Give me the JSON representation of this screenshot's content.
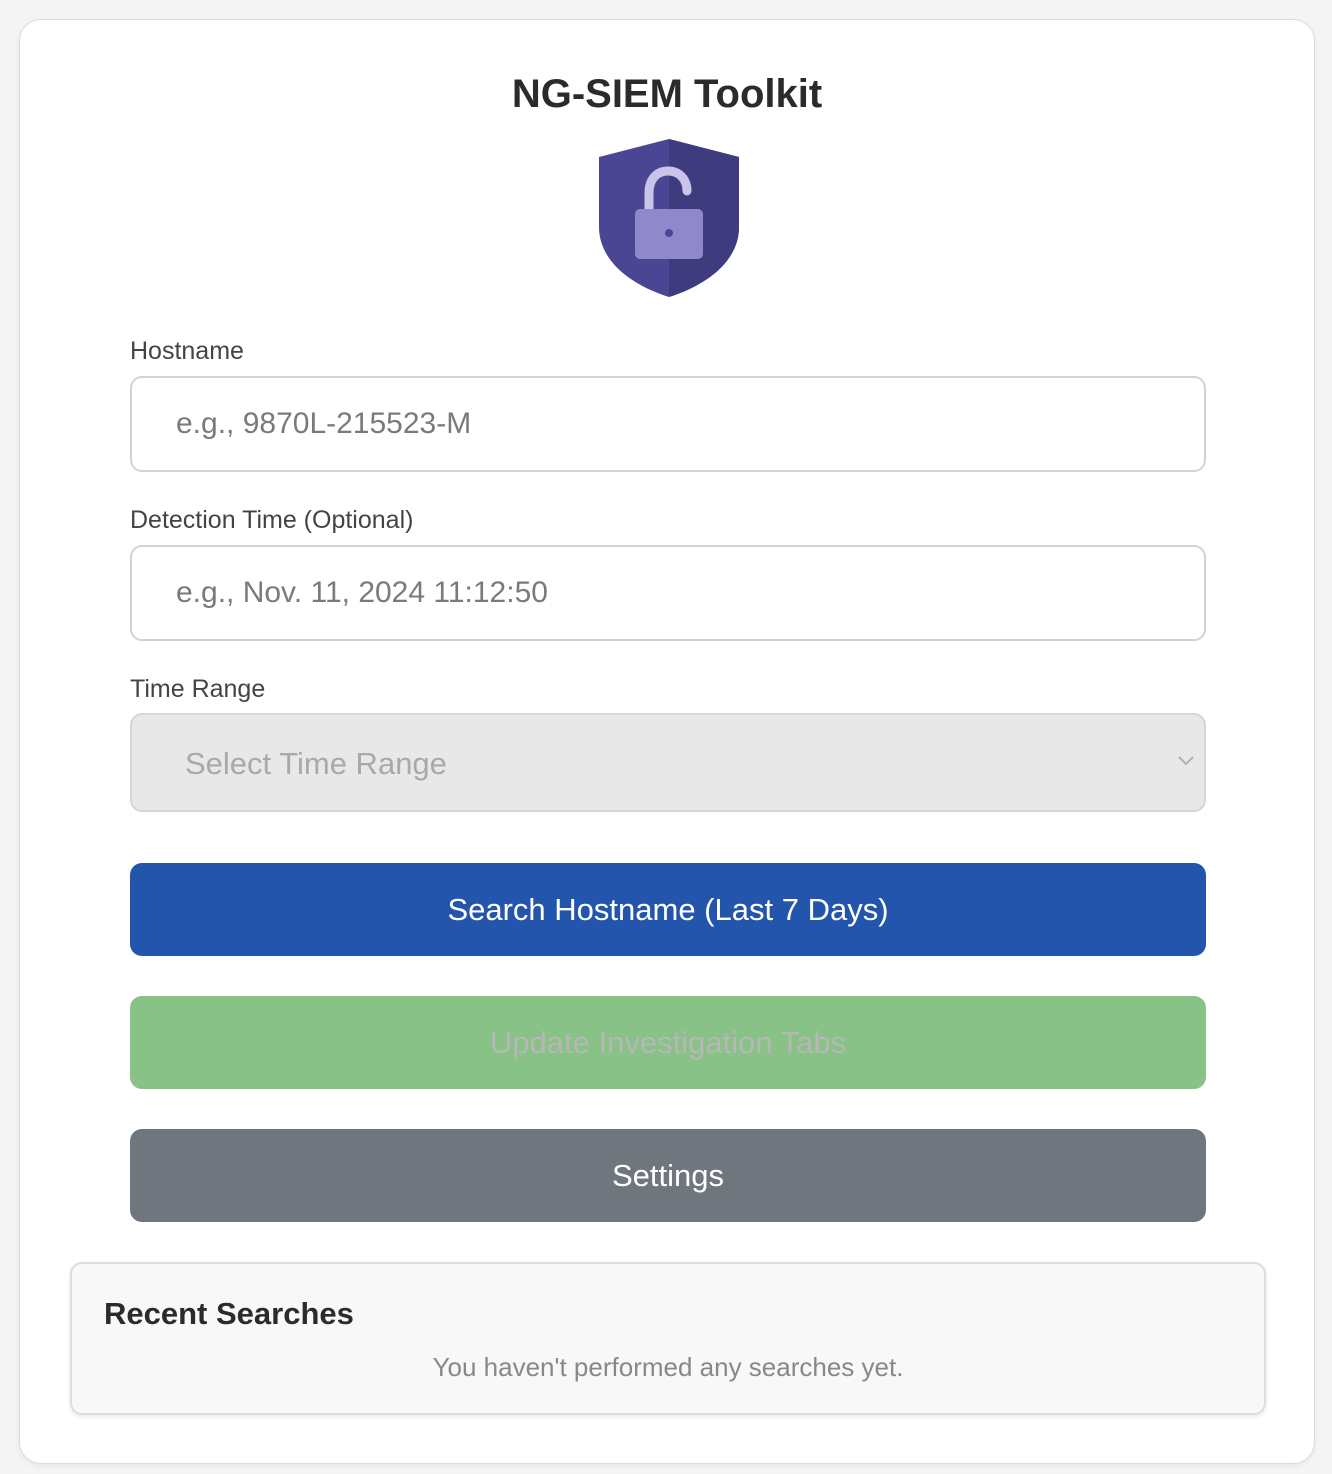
{
  "app": {
    "title": "NG-SIEM Toolkit",
    "logo_icon": "shield-unlocked-padlock-icon",
    "colors": {
      "shield": "#4a4694",
      "primary": "#2455ac",
      "success": "#88c287",
      "secondary": "#6f767e"
    }
  },
  "form": {
    "hostname": {
      "label": "Hostname",
      "placeholder": "e.g., 9870L-215523-M",
      "value": ""
    },
    "detection_time": {
      "label": "Detection Time (Optional)",
      "placeholder": "e.g., Nov. 11, 2024 11:12:50",
      "value": ""
    },
    "time_range": {
      "label": "Time Range",
      "selected": "Select Time Range",
      "disabled": true,
      "icon": "chevron-down-icon"
    }
  },
  "buttons": {
    "search": "Search Hostname (Last 7 Days)",
    "update": "Update Investigation Tabs",
    "settings": "Settings"
  },
  "recent": {
    "title": "Recent Searches",
    "empty_message": "You haven't performed any searches yet."
  }
}
